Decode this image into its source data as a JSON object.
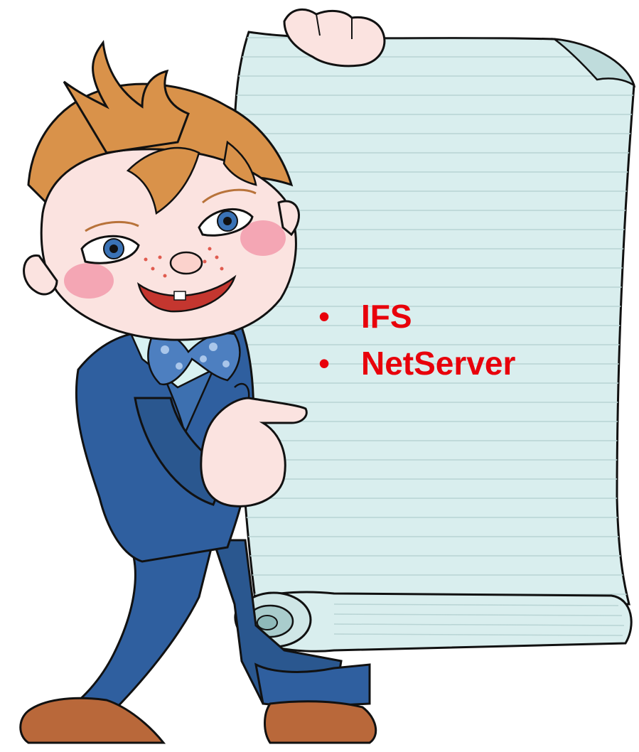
{
  "slide": {
    "bullets": [
      {
        "text": "IFS"
      },
      {
        "text": "NetServer"
      }
    ],
    "bullet_glyph": "•",
    "text_color": "#e8000b"
  },
  "illustration": {
    "icon": "boy-holding-scroll-illustration",
    "colors": {
      "scroll_paper": "#d9eeee",
      "scroll_lines": "#b8d4d4",
      "suit": "#2f5f9f",
      "hair": "#d9924a",
      "skin": "#fbe3e0",
      "bowtie": "#4d7fc0",
      "shoes": "#b9683a"
    }
  }
}
